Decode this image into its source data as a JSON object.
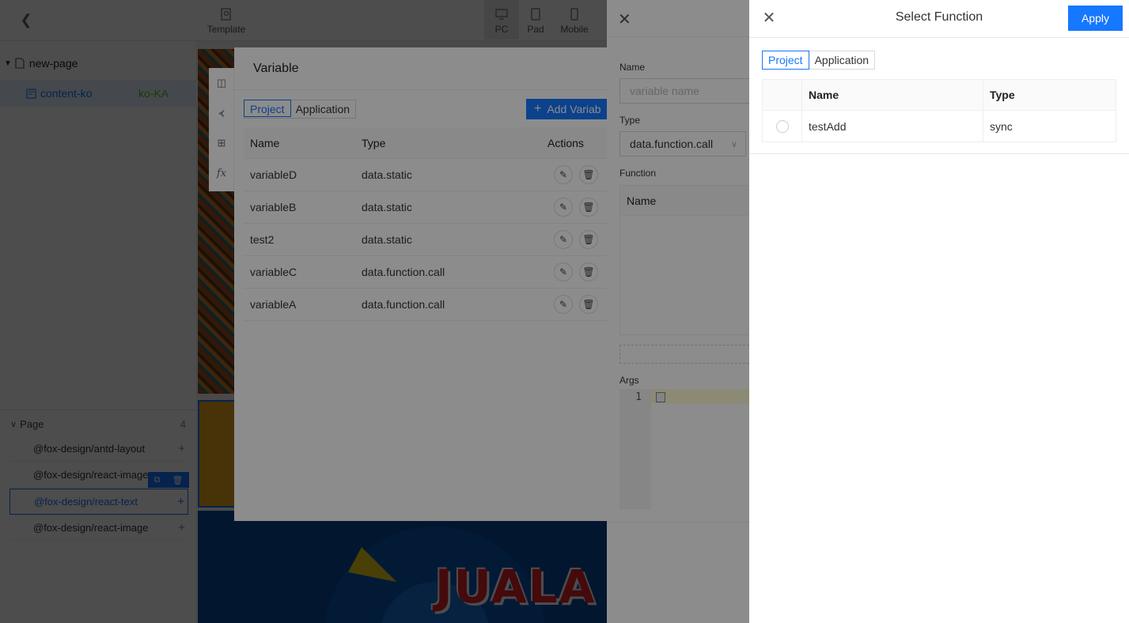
{
  "toolbar": {
    "template_label": "Template",
    "devices": [
      "PC",
      "Pad",
      "Mobile"
    ]
  },
  "pages": {
    "root": "new-page",
    "child": "content-ko",
    "child_locale": "ko-KA"
  },
  "layers": {
    "title": "Page",
    "count": "4",
    "items": [
      "@fox-design/antd-layout",
      "@fox-design/react-image",
      "@fox-design/react-text",
      "@fox-design/react-image"
    ]
  },
  "canvas": {
    "banner_text": "JUALA"
  },
  "variable_drawer": {
    "title": "Variable",
    "tabs": [
      "Project",
      "Application"
    ],
    "add_label": "Add Variab",
    "columns": [
      "Name",
      "Type",
      "Actions"
    ],
    "rows": [
      {
        "name": "variableD",
        "type": "data.static"
      },
      {
        "name": "variableB",
        "type": "data.static"
      },
      {
        "name": "test2",
        "type": "data.static"
      },
      {
        "name": "variableC",
        "type": "data.function.call"
      },
      {
        "name": "variableA",
        "type": "data.function.call"
      }
    ],
    "side_tab_fx": "fx"
  },
  "variable_form": {
    "name_label": "Name",
    "name_placeholder": "variable name",
    "type_label": "Type",
    "type_value": "data.function.call",
    "function_label": "Function",
    "function_col": "Name",
    "args_label": "Args",
    "line_number": "1"
  },
  "select_function": {
    "title": "Select Function",
    "apply_label": "Apply",
    "tabs": [
      "Project",
      "Application"
    ],
    "columns": [
      "Name",
      "Type"
    ],
    "rows": [
      {
        "name": "testAdd",
        "type": "sync"
      }
    ]
  },
  "colors": {
    "primary": "#1677ff",
    "mask": "rgba(0,0,0,0.45)",
    "text_block": "#f0a91c"
  }
}
